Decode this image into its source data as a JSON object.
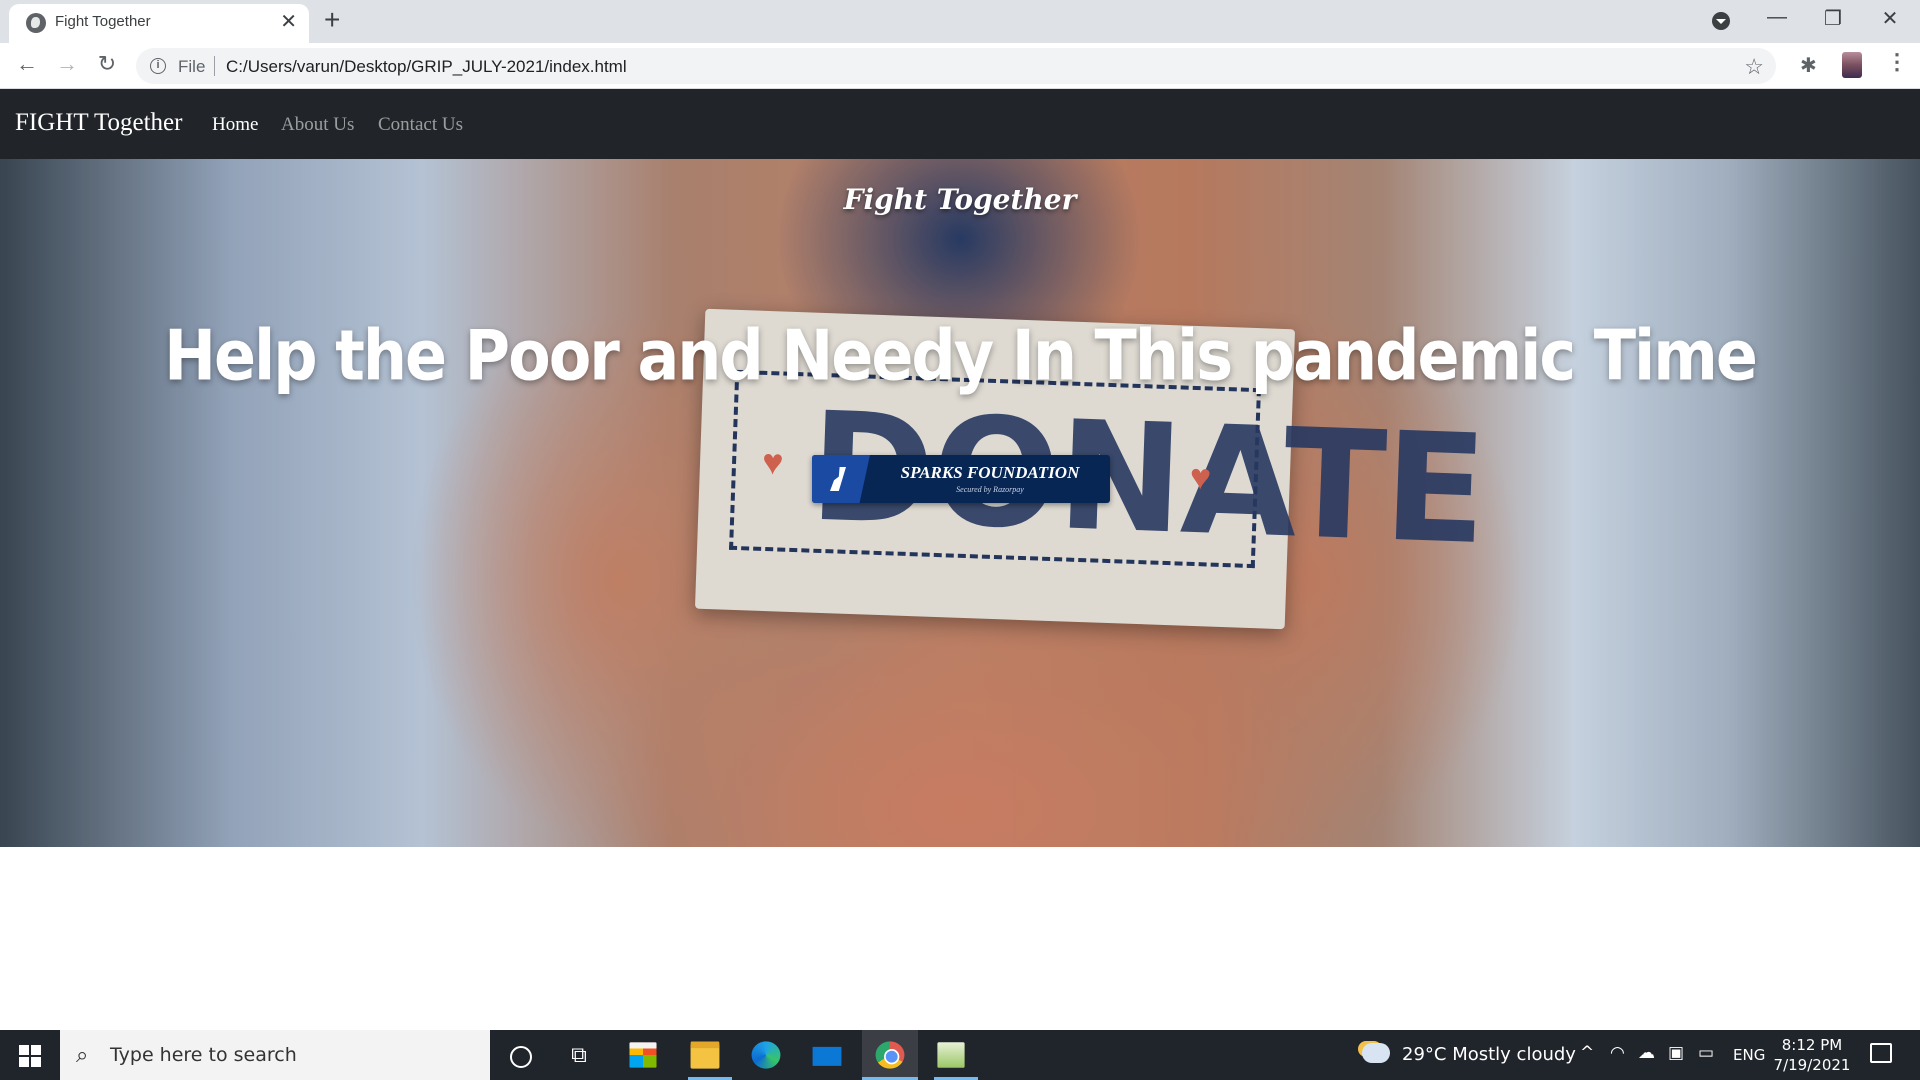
{
  "browser": {
    "tab_title": "Fight Together",
    "tab_close": "✕",
    "new_tab": "+",
    "scheme": "File",
    "url": "C:/Users/varun/Desktop/GRIP_JULY-2021/index.html",
    "window_controls": [
      "—",
      "❐",
      "✕"
    ]
  },
  "site": {
    "brand": "FIGHT Together",
    "nav": [
      {
        "label": "Home",
        "active": true
      },
      {
        "label": "About Us",
        "active": false
      },
      {
        "label": "Contact Us",
        "active": false
      }
    ]
  },
  "hero": {
    "tagline": "Fight Together",
    "heading": "Help the Poor and Needy In This pandemic Time",
    "image_card_word": "DONATE",
    "donate_button": {
      "label": "SPARKS FOUNDATION",
      "sublabel": "Secured by Razorpay"
    }
  },
  "taskbar": {
    "search_placeholder": "Type here to search",
    "weather": "29°C  Mostly cloudy",
    "language": "ENG",
    "time": "8:12 PM",
    "date": "7/19/2021"
  },
  "colors": {
    "navbar_bg": "#212529",
    "button_bg": "#072654",
    "taskbar_bg": "#20242b"
  }
}
